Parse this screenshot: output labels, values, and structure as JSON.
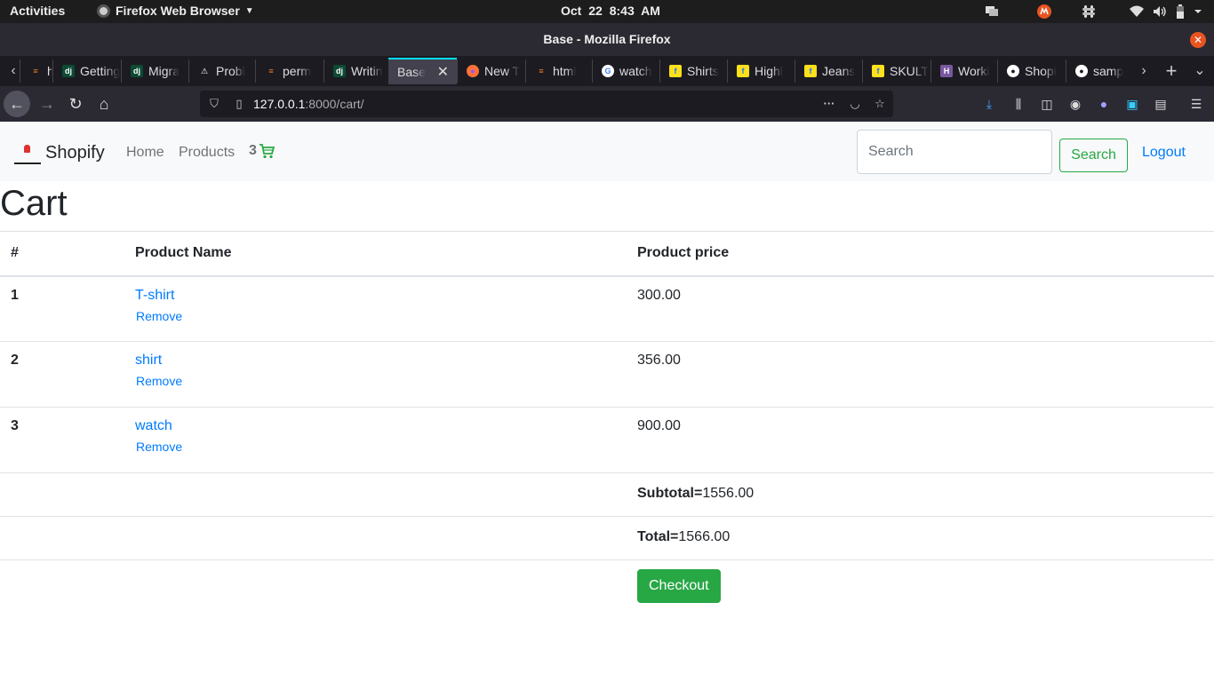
{
  "os_bar": {
    "activities": "Activities",
    "app_name": "Firefox Web Browser",
    "date": "Oct 22",
    "time": "8:43 AM"
  },
  "window": {
    "title": "Base - Mozilla Firefox"
  },
  "tabs": [
    {
      "label": "hot",
      "icon": "stackoverflow-icon",
      "color": "#f48024"
    },
    {
      "label": "Getting",
      "icon": "django-icon",
      "color": "#0c4b33"
    },
    {
      "label": "Migra",
      "icon": "django-icon",
      "color": "#0c4b33"
    },
    {
      "label": "Probl",
      "icon": "warning-icon",
      "color": "#444444"
    },
    {
      "label": "perm",
      "icon": "stackoverflow-icon",
      "color": "#f48024"
    },
    {
      "label": "Writin",
      "icon": "django-icon",
      "color": "#0c4b33"
    },
    {
      "label": "Base",
      "icon": "none",
      "color": "#42414d",
      "active": true
    },
    {
      "label": "New T",
      "icon": "firefox-icon",
      "color": "#ff7139"
    },
    {
      "label": "html",
      "icon": "stackoverflow-icon",
      "color": "#f48024"
    },
    {
      "label": "watch",
      "icon": "google-icon",
      "color": "#ffffff"
    },
    {
      "label": "Shirts",
      "icon": "flipkart-icon",
      "color": "#ffe11b"
    },
    {
      "label": "Highl",
      "icon": "flipkart-icon",
      "color": "#ffe11b"
    },
    {
      "label": "Jeans",
      "icon": "flipkart-icon",
      "color": "#ffe11b"
    },
    {
      "label": "SKULT",
      "icon": "flipkart-icon",
      "color": "#ffe11b"
    },
    {
      "label": "Worki",
      "icon": "heroku-icon",
      "color": "#79589f"
    },
    {
      "label": "Shopi",
      "icon": "github-icon",
      "color": "#ffffff"
    },
    {
      "label": "samp",
      "icon": "github-icon",
      "color": "#ffffff"
    }
  ],
  "url": {
    "host": "127.0.0.1",
    "rest": ":8000/cart/"
  },
  "site": {
    "brand": "Shopify",
    "nav": {
      "home": "Home",
      "products": "Products"
    },
    "cart_count": "3",
    "search_placeholder": "Search",
    "search_button": "Search",
    "logout": "Logout",
    "accent_color": "#28a745",
    "link_color": "#007bff"
  },
  "cart": {
    "title": "Cart",
    "headers": {
      "num": "#",
      "name": "Product Name",
      "price": "Product price"
    },
    "items": [
      {
        "num": "1",
        "name": "T-shirt",
        "remove": "Remove",
        "price": "300.00"
      },
      {
        "num": "2",
        "name": "shirt",
        "remove": "Remove",
        "price": "356.00"
      },
      {
        "num": "3",
        "name": "watch",
        "remove": "Remove",
        "price": "900.00"
      }
    ],
    "subtotal_label": "Subtotal=",
    "subtotal_value": "1556.00",
    "total_label": "Total=",
    "total_value": "1566.00",
    "checkout": "Checkout"
  }
}
